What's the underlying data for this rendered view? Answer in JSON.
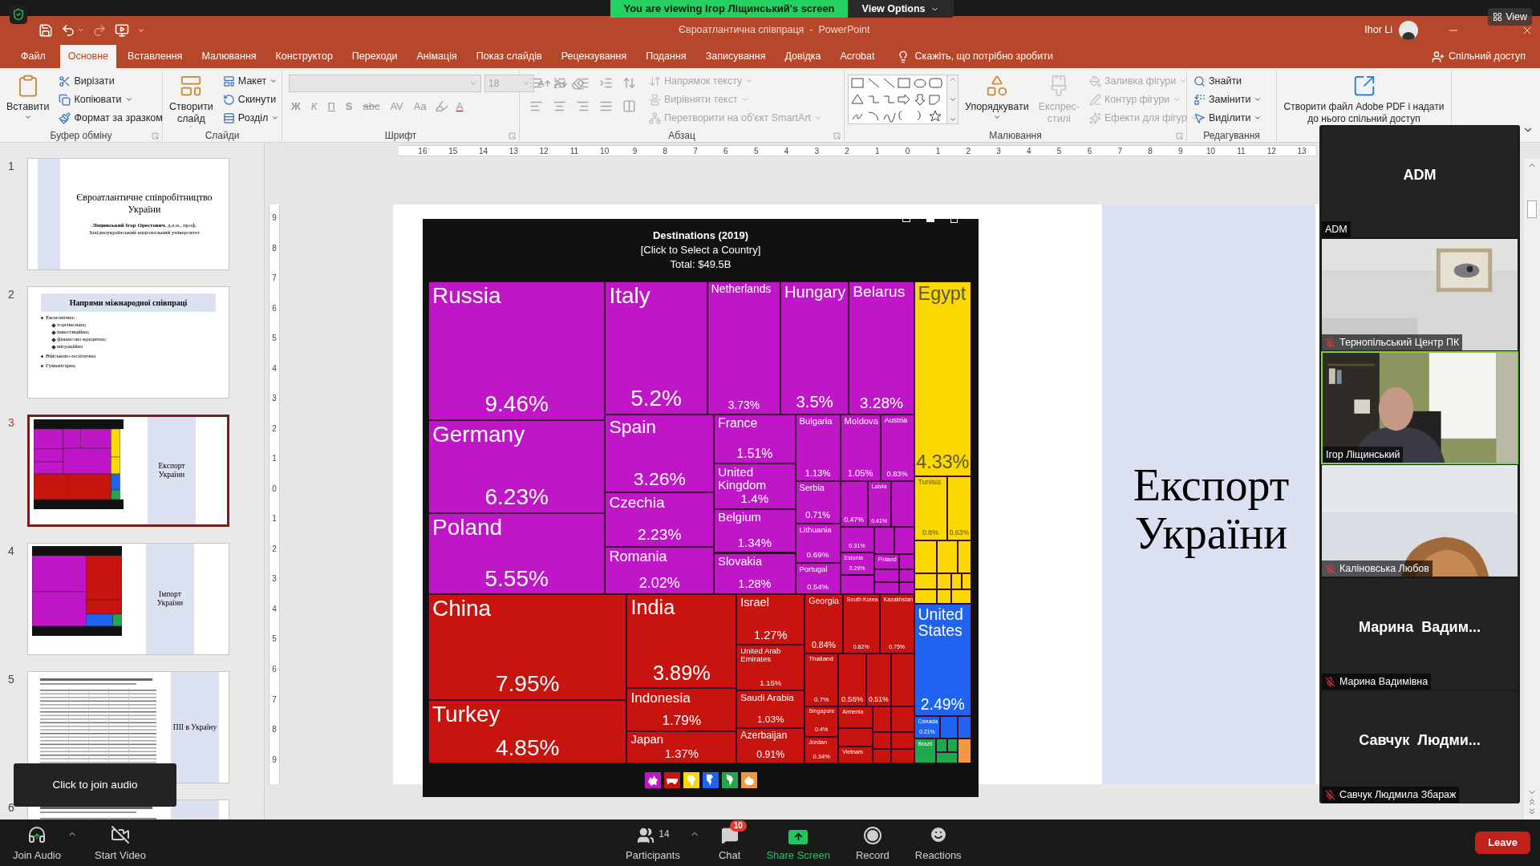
{
  "zoom_banner": {
    "text": "You are viewing Ігор Ліщинський's screen",
    "view_options": "View Options",
    "view": "View"
  },
  "window": {
    "title": "Євроатлантична співпраця  -  PowerPoint",
    "user": "Ihor Li"
  },
  "tabs": [
    {
      "label": "Файл",
      "selected": false
    },
    {
      "label": "Основне",
      "selected": true
    },
    {
      "label": "Вставлення",
      "selected": false
    },
    {
      "label": "Малювання",
      "selected": false
    },
    {
      "label": "Конструктор",
      "selected": false
    },
    {
      "label": "Переходи",
      "selected": false
    },
    {
      "label": "Анімація",
      "selected": false
    },
    {
      "label": "Показ слайдів",
      "selected": false
    },
    {
      "label": "Рецензування",
      "selected": false
    },
    {
      "label": "Подання",
      "selected": false
    },
    {
      "label": "Записування",
      "selected": false
    },
    {
      "label": "Довідка",
      "selected": false
    },
    {
      "label": "Acrobat",
      "selected": false
    }
  ],
  "tell_me": "Скажіть, що потрібно зробити",
  "share": "Спільний доступ",
  "ribbon": [
    {
      "label": "Буфер обміну",
      "launcher": true,
      "sections": [
        {
          "kind": "large",
          "label": "Вставити",
          "disabled": false,
          "dropdown": true
        },
        {
          "kind": "column",
          "items": [
            {
              "label": "Вирізати",
              "disabled": false,
              "dropdown": false
            },
            {
              "label": "Копіювати",
              "disabled": false,
              "dropdown": true
            },
            {
              "label": "Формат за зразком",
              "disabled": false,
              "dropdown": false
            }
          ]
        }
      ]
    },
    {
      "label": "Слайди",
      "launcher": false,
      "sections": [
        {
          "kind": "large",
          "label": "Створити слайд",
          "disabled": false,
          "dropdown": true
        },
        {
          "kind": "column",
          "items": [
            {
              "label": "Макет",
              "disabled": false,
              "dropdown": true
            },
            {
              "label": "Скинути",
              "disabled": false,
              "dropdown": false
            },
            {
              "label": "Розділ",
              "disabled": false,
              "dropdown": true
            }
          ]
        }
      ]
    },
    {
      "label": "Шрифт",
      "launcher": true,
      "sections": [
        {
          "kind": "font",
          "size": "18",
          "buttons": [
            {
              "label": "Ж",
              "disabled": true
            },
            {
              "label": "К",
              "disabled": true
            },
            {
              "label": "П",
              "disabled": true
            },
            {
              "label": "S",
              "disabled": true
            },
            {
              "label": "abc",
              "disabled": true
            },
            {
              "label": "AV",
              "disabled": true
            },
            {
              "label": "Aa",
              "disabled": true
            },
            {
              "label": "A",
              "disabled": true
            }
          ]
        }
      ]
    },
    {
      "label": "Абзац",
      "launcher": true,
      "sections": [
        {
          "kind": "paragraph"
        },
        {
          "kind": "column",
          "items": [
            {
              "label": "Напрямок тексту",
              "disabled": true,
              "dropdown": true
            },
            {
              "label": "Вирівняти текст",
              "disabled": true,
              "dropdown": true
            },
            {
              "label": "Перетворити на об'єкт SmartArt",
              "disabled": true,
              "dropdown": true
            }
          ]
        }
      ]
    },
    {
      "label": "Малювання",
      "launcher": true,
      "sections": [
        {
          "kind": "gallery"
        },
        {
          "kind": "large",
          "label": "Упорядкувати",
          "disabled": false,
          "dropdown": true
        },
        {
          "kind": "large",
          "label": "Експрес-стилі",
          "disabled": true,
          "dropdown": true
        },
        {
          "kind": "column",
          "items": [
            {
              "label": "Заливка фігури",
              "disabled": true,
              "dropdown": true
            },
            {
              "label": "Контур фігури",
              "disabled": true,
              "dropdown": true
            },
            {
              "label": "Ефекти для фігур",
              "disabled": true,
              "dropdown": true
            }
          ]
        }
      ]
    },
    {
      "label": "Редагування",
      "launcher": false,
      "sections": [
        {
          "kind": "column",
          "items": [
            {
              "label": "Знайти",
              "disabled": false,
              "dropdown": false
            },
            {
              "label": "Замінити",
              "disabled": false,
              "dropdown": true
            },
            {
              "label": "Виділити",
              "disabled": false,
              "dropdown": true
            }
          ]
        }
      ]
    },
    {
      "sections": [
        {
          "kind": "large",
          "label": "Створити файл Adobe PDF і надати до нього спільний доступ",
          "disabled": false
        }
      ]
    }
  ],
  "slides": [
    {
      "number": "1",
      "selected": false,
      "kind": "title",
      "title": "Євроатлантичне співробітництво України",
      "author": "**Ліщинський Ігор Орестович**, д.е.н., проф.",
      "affiliation": "Західноукраїнський національний університет"
    },
    {
      "number": "2",
      "selected": false,
      "kind": "bullets",
      "title": "Напрями міжнародної співпраці",
      "bullets": [
        {
          "text": "Економічна:",
          "children": [
            {
              "text": "торгівельна;"
            },
            {
              "text": "інвестиційна;"
            },
            {
              "text": "фінансово-кредитна;"
            },
            {
              "text": "міграційна"
            }
          ]
        },
        {
          "text": "Військово-політична"
        },
        {
          "text": "Гуманітарна"
        }
      ]
    },
    {
      "number": "3",
      "selected": true,
      "kind": "treemap",
      "caption": "Експорт України"
    },
    {
      "number": "4",
      "selected": false,
      "kind": "treemap",
      "caption": "Імпорт України"
    },
    {
      "number": "5",
      "selected": false,
      "kind": "table",
      "caption": "ПІІ в Україну"
    },
    {
      "number": "6",
      "selected": false,
      "kind": "table"
    }
  ],
  "ruler": {
    "horizontal": [
      "16",
      "15",
      "14",
      "13",
      "12",
      "11",
      "10",
      "9",
      "8",
      "7",
      "6",
      "5",
      "4",
      "3",
      "2",
      "1",
      "0",
      "1",
      "2",
      "3",
      "4",
      "5",
      "6",
      "7",
      "8",
      "9",
      "10",
      "11",
      "12",
      "13"
    ],
    "vertical": [
      "9",
      "8",
      "7",
      "6",
      "5",
      "4",
      "3",
      "2",
      "1",
      "0",
      "1",
      "2",
      "3",
      "4",
      "5",
      "6",
      "7",
      "8",
      "9"
    ]
  },
  "slide": {
    "title": "Експорт України",
    "treemap": {
      "title": "Destinations (2019)",
      "subtitle": "[Click to Select a Country]",
      "total": "Total: $49.5B",
      "tiles": [
        {
          "name": "Russia",
          "share": "9.46%",
          "color": "#bf17c7"
        },
        {
          "name": "Germany",
          "share": "6.23%",
          "color": "#bf17c7"
        },
        {
          "name": "Poland",
          "share": "5.55%",
          "color": "#bf17c7"
        },
        {
          "name": "Italy",
          "share": "5.2%",
          "color": "#bf17c7"
        },
        {
          "name": "Netherlands",
          "share": "3.73%",
          "color": "#bf17c7"
        },
        {
          "name": "Hungary",
          "share": "3.5%",
          "color": "#bf17c7"
        },
        {
          "name": "Belarus",
          "share": "3.28%",
          "color": "#bf17c7"
        },
        {
          "name": "Spain",
          "share": "3.26%",
          "color": "#bf17c7"
        },
        {
          "name": "Czechia",
          "share": "2.23%",
          "color": "#bf17c7"
        },
        {
          "name": "Romania",
          "share": "2.02%",
          "color": "#bf17c7"
        },
        {
          "name": "France",
          "share": "1.51%",
          "color": "#bf17c7"
        },
        {
          "name": "United Kingdom",
          "share": "1.4%",
          "color": "#bf17c7"
        },
        {
          "name": "Belgium",
          "share": "1.34%",
          "color": "#bf17c7"
        },
        {
          "name": "Slovakia",
          "share": "1.28%",
          "color": "#bf17c7"
        },
        {
          "name": "Bulgaria",
          "share": "1.13%",
          "color": "#bf17c7"
        },
        {
          "name": "Moldova",
          "share": "1.05%",
          "color": "#bf17c7"
        },
        {
          "name": "Austria",
          "share": "0.83%",
          "color": "#bf17c7"
        },
        {
          "name": "Serbia",
          "share": "0.71%",
          "color": "#bf17c7"
        },
        {
          "name": "Lithuania",
          "share": "0.69%",
          "color": "#bf17c7"
        },
        {
          "name": "Portugal",
          "share": "0.54%",
          "color": "#bf17c7"
        },
        {
          "share": "0.47%",
          "color": "#bf17c7"
        },
        {
          "name": "Latvia",
          "share": "0.41%",
          "color": "#bf17c7"
        },
        {
          "color": "#bf17c7"
        },
        {
          "share": "0.31%",
          "color": "#bf17c7"
        },
        {
          "name": "Estonia",
          "share": "0.29%",
          "color": "#bf17c7"
        },
        {
          "color": "#bf17c7"
        },
        {
          "color": "#bf17c7"
        },
        {
          "name": "Finland",
          "color": "#bf17c7"
        },
        {
          "color": "#bf17c7"
        },
        {
          "color": "#bf17c7"
        },
        {
          "color": "#bf17c7"
        },
        {
          "color": "#bf17c7"
        },
        {
          "color": "#bf17c7"
        },
        {
          "color": "#bf17c7"
        },
        {
          "name": "Egypt",
          "share": "4.33%",
          "color": "#fad800"
        },
        {
          "name": "Tunisia",
          "share": "0.8%",
          "color": "#fad800"
        },
        {
          "share": "0.63%",
          "color": "#fad800"
        },
        {
          "color": "#fad800"
        },
        {
          "color": "#fad800"
        },
        {
          "color": "#fad800"
        },
        {
          "color": "#fad800"
        },
        {
          "color": "#fad800"
        },
        {
          "color": "#fad800"
        },
        {
          "color": "#fad800"
        },
        {
          "color": "#fad800"
        },
        {
          "color": "#fad800"
        },
        {
          "color": "#fad800"
        },
        {
          "name": "United States",
          "share": "2.49%",
          "color": "#1f63f2"
        },
        {
          "name": "Canada",
          "share": "0.21%",
          "color": "#1f63f2"
        },
        {
          "color": "#1f63f2"
        },
        {
          "color": "#1f63f2"
        },
        {
          "name": "Brazil",
          "color": "#21a84e"
        },
        {
          "color": "#21a84e"
        },
        {
          "color": "#21a84e"
        },
        {
          "color": "#21a84e"
        },
        {
          "color": "#f2993f"
        },
        {
          "name": "China",
          "share": "7.95%",
          "color": "#c8140e"
        },
        {
          "name": "Turkey",
          "share": "4.85%",
          "color": "#c8140e"
        },
        {
          "name": "India",
          "share": "3.89%",
          "color": "#c8140e"
        },
        {
          "name": "Indonesia",
          "share": "1.79%",
          "color": "#c8140e"
        },
        {
          "name": "Japan",
          "share": "1.37%",
          "color": "#c8140e"
        },
        {
          "name": "Israel",
          "share": "1.27%",
          "color": "#c8140e"
        },
        {
          "name": "United Arab Emirates",
          "share": "1.15%",
          "color": "#c8140e"
        },
        {
          "name": "Saudi Arabia",
          "share": "1.03%",
          "color": "#c8140e"
        },
        {
          "name": "Azerbaijan",
          "share": "0.91%",
          "color": "#c8140e"
        },
        {
          "name": "Georgia",
          "share": "0.84%",
          "color": "#c8140e"
        },
        {
          "name": "South Korea",
          "share": "0.82%",
          "color": "#c8140e"
        },
        {
          "name": "Kazakhstan",
          "share": "0.75%",
          "color": "#c8140e"
        },
        {
          "name": "Thailand",
          "share": "0.7%",
          "color": "#c8140e"
        },
        {
          "share": "0.56%",
          "color": "#c8140e"
        },
        {
          "share": "0.51%",
          "color": "#c8140e"
        },
        {
          "color": "#c8140e"
        },
        {
          "name": "Singapore",
          "share": "0.4%",
          "color": "#c8140e"
        },
        {
          "name": "Jordan",
          "share": "0.34%",
          "color": "#c8140e"
        },
        {
          "name": "Armenia",
          "color": "#c8140e"
        },
        {
          "color": "#c8140e"
        },
        {
          "name": "Vietnam",
          "color": "#c8140e"
        },
        {
          "color": "#c8140e"
        },
        {
          "color": "#c8140e"
        },
        {
          "color": "#c8140e"
        },
        {
          "color": "#c8140e"
        },
        {
          "color": "#c8140e"
        },
        {
          "color": "#c8140e"
        }
      ],
      "legend": [
        {
          "color": "#bf17c7"
        },
        {
          "color": "#c8140e"
        },
        {
          "color": "#fad800"
        },
        {
          "color": "#1f63f2"
        },
        {
          "color": "#21a84e"
        },
        {
          "color": "#f2993f"
        }
      ]
    }
  },
  "participants": [
    {
      "kind": "name_only",
      "display": "ADM",
      "name": "ADM",
      "muted": false,
      "speaking": false
    },
    {
      "kind": "video",
      "name": "Тернопільський Центр ПК",
      "muted": true,
      "speaking": false
    },
    {
      "kind": "video",
      "name": "Ігор Ліщинський",
      "muted": false,
      "speaking": true
    },
    {
      "kind": "video",
      "name": "Каліновська Любов",
      "muted": true,
      "speaking": false
    },
    {
      "kind": "name_only",
      "display": "Марина  Вадим...",
      "name": "Марина Вадимівна",
      "muted": true,
      "speaking": false
    },
    {
      "kind": "name_only",
      "display": "Савчук  Людми...",
      "name": "Савчук Людмила Збараж",
      "muted": true,
      "speaking": false
    }
  ],
  "audio_tooltip": "Click to join audio",
  "toolbar": {
    "left": [
      {
        "kind": "audio",
        "label": "Join Audio"
      },
      {
        "kind": "video",
        "label": "Start Video"
      }
    ],
    "center": [
      {
        "kind": "participants",
        "label": "Participants",
        "count": "14"
      },
      {
        "kind": "chat",
        "label": "Chat",
        "badge": "10"
      },
      {
        "kind": "share",
        "label": "Share Screen"
      },
      {
        "kind": "record",
        "label": "Record"
      },
      {
        "kind": "reactions",
        "label": "Reactions"
      }
    ],
    "leave": "Leave"
  }
}
